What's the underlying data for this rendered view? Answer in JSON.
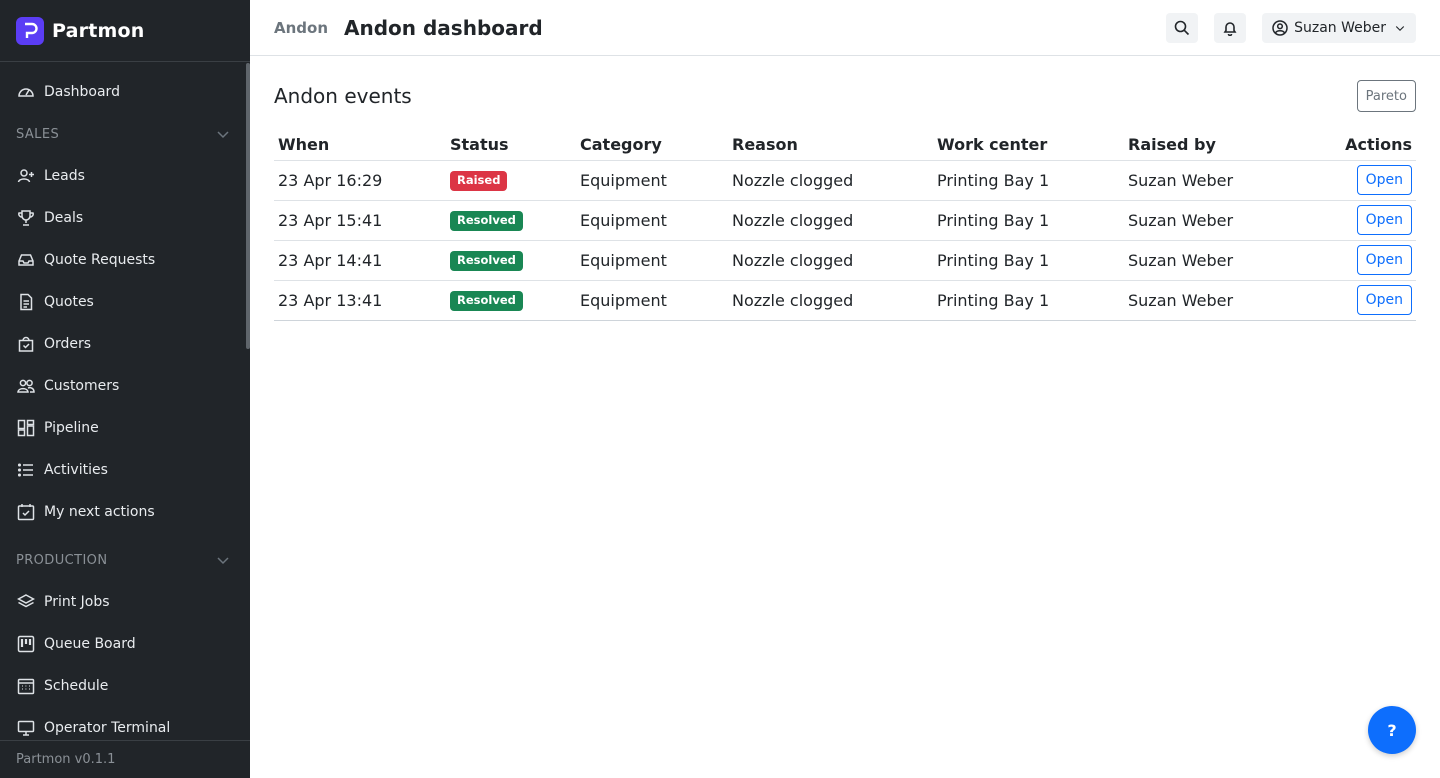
{
  "app": {
    "name": "Partmon",
    "version": "Partmon v0.1.1"
  },
  "sidebar": {
    "dashboard": "Dashboard",
    "sections": [
      {
        "label": "SALES",
        "items": [
          "Leads",
          "Deals",
          "Quote Requests",
          "Quotes",
          "Orders",
          "Customers",
          "Pipeline",
          "Activities",
          "My next actions"
        ]
      },
      {
        "label": "PRODUCTION",
        "items": [
          "Print Jobs",
          "Queue Board",
          "Schedule",
          "Operator Terminal"
        ]
      }
    ]
  },
  "header": {
    "breadcrumb": "Andon",
    "title": "Andon dashboard",
    "user": "Suzan Weber"
  },
  "main": {
    "card_title": "Andon events",
    "pareto_label": "Pareto",
    "columns": [
      "When",
      "Status",
      "Category",
      "Reason",
      "Work center",
      "Raised by",
      "Actions"
    ],
    "rows": [
      {
        "when": "23 Apr 16:29",
        "status": "Raised",
        "category": "Equipment",
        "reason": "Nozzle clogged",
        "work_center": "Printing Bay 1",
        "raised_by": "Suzan Weber",
        "action": "Open"
      },
      {
        "when": "23 Apr 15:41",
        "status": "Resolved",
        "category": "Equipment",
        "reason": "Nozzle clogged",
        "work_center": "Printing Bay 1",
        "raised_by": "Suzan Weber",
        "action": "Open"
      },
      {
        "when": "23 Apr 14:41",
        "status": "Resolved",
        "category": "Equipment",
        "reason": "Nozzle clogged",
        "work_center": "Printing Bay 1",
        "raised_by": "Suzan Weber",
        "action": "Open"
      },
      {
        "when": "23 Apr 13:41",
        "status": "Resolved",
        "category": "Equipment",
        "reason": "Nozzle clogged",
        "work_center": "Printing Bay 1",
        "raised_by": "Suzan Weber",
        "action": "Open"
      }
    ]
  },
  "help": {
    "label": "?"
  },
  "colors": {
    "sidebar_bg": "#212529",
    "brand": "#5b3df5",
    "primary": "#0d6efd",
    "danger": "#dc3545",
    "success": "#198754"
  }
}
